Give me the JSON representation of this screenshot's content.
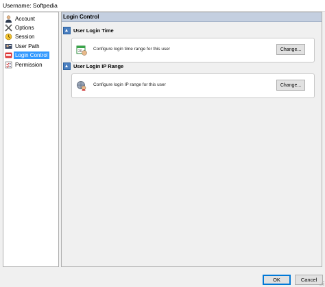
{
  "window": {
    "title": "Username: Softpedia"
  },
  "sidebar": {
    "items": [
      {
        "label": "Account",
        "icon": "user-account-icon",
        "selected": false
      },
      {
        "label": "Options",
        "icon": "tools-icon",
        "selected": false
      },
      {
        "label": "Session",
        "icon": "session-icon",
        "selected": false
      },
      {
        "label": "User Path",
        "icon": "user-path-icon",
        "selected": false
      },
      {
        "label": "Login Control",
        "icon": "login-control-icon",
        "selected": true
      },
      {
        "label": "Permission",
        "icon": "permission-icon",
        "selected": false
      }
    ]
  },
  "panel": {
    "header": "Login Control",
    "sections": [
      {
        "title": "User Login Time",
        "description": "Configure login time range for this user",
        "button": "Change...",
        "icon": "calendar-icon"
      },
      {
        "title": "User Login IP Range",
        "description": "Configure login IP range for this user",
        "button": "Change...",
        "icon": "ip-range-icon"
      }
    ]
  },
  "footer": {
    "ok": "OK",
    "cancel": "Cancel"
  },
  "colors": {
    "selection": "#3399ff",
    "header_bg": "#c4cfe0"
  }
}
